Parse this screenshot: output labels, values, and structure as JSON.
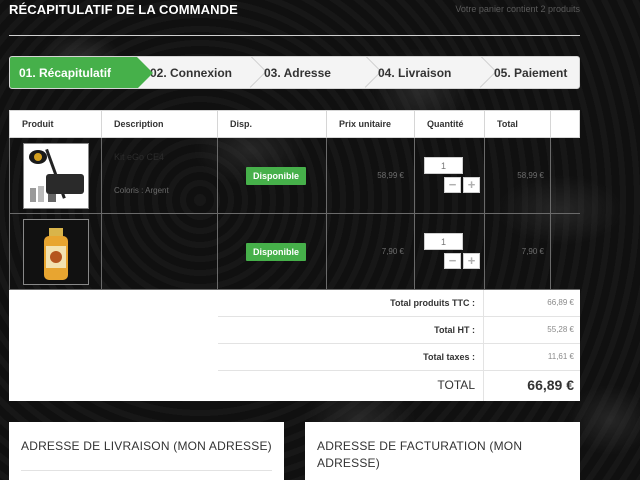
{
  "header": {
    "title": "RÉCAPITULATIF DE LA COMMANDE",
    "cart_count": "Votre panier contient 2 produits"
  },
  "steps": [
    {
      "label": "01. Récapitulatif",
      "active": true
    },
    {
      "label": "02. Connexion",
      "active": false
    },
    {
      "label": "03. Adresse",
      "active": false
    },
    {
      "label": "04. Livraison",
      "active": false
    },
    {
      "label": "05. Paiement",
      "active": false
    }
  ],
  "table": {
    "headers": {
      "product": "Produit",
      "description": "Description",
      "availability": "Disp.",
      "unit_price": "Prix unitaire",
      "quantity": "Quantité",
      "total": "Total"
    },
    "rows": [
      {
        "description_name": "Kit eGo CE4",
        "description_sub": "Coloris : Argent",
        "availability": "Disponible",
        "unit_price": "58,99 €",
        "quantity": "1",
        "total": "58,99 €"
      },
      {
        "description_name": "",
        "description_sub": "",
        "availability": "Disponible",
        "unit_price": "7,90 €",
        "quantity": "1",
        "total": "7,90 €"
      }
    ],
    "qty_minus": "−",
    "qty_plus": "+"
  },
  "totals": {
    "products_ttc_label": "Total produits TTC :",
    "products_ttc_value": "66,89 €",
    "ht_label": "Total HT :",
    "ht_value": "55,28 €",
    "taxes_label": "Total taxes :",
    "taxes_value": "11,61 €",
    "total_label": "TOTAL",
    "total_value": "66,89 €"
  },
  "addresses": {
    "delivery_title": "ADRESSE DE LIVRAISON (MON ADRESSE)",
    "billing_title": "ADRESSE DE FACTURATION (MON ADRESSE)"
  },
  "colors": {
    "accent_green": "#46b04a",
    "background": "#101010"
  }
}
